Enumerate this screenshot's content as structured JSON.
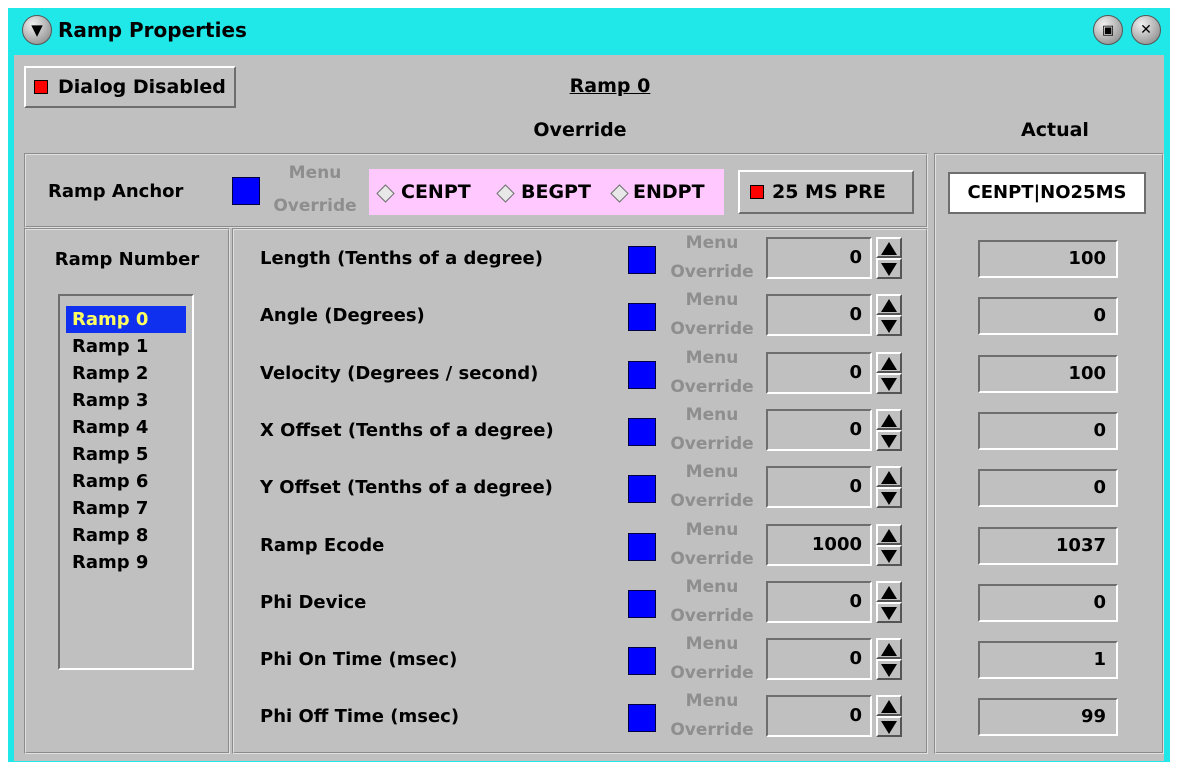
{
  "window": {
    "title": "Ramp Properties"
  },
  "header": {
    "dialog_disabled_label": "Dialog Disabled",
    "current_ramp": "Ramp 0",
    "override_heading": "Override",
    "actual_heading": "Actual"
  },
  "anchor": {
    "label": "Ramp Anchor",
    "menu_override": [
      "Menu",
      "Override"
    ],
    "options": [
      "CENPT",
      "BEGPT",
      "ENDPT"
    ],
    "pre_label": "25 MS PRE",
    "actual_value": "CENPT|NO25MS"
  },
  "ramp_list": {
    "heading": "Ramp Number",
    "selected_index": 0,
    "items": [
      "Ramp 0",
      "Ramp 1",
      "Ramp 2",
      "Ramp 3",
      "Ramp 4",
      "Ramp 5",
      "Ramp 6",
      "Ramp 7",
      "Ramp 8",
      "Ramp 9"
    ]
  },
  "params": [
    {
      "label": "Length (Tenths of a degree)",
      "menu": "Menu",
      "override": "Override",
      "value": "0",
      "actual": "100"
    },
    {
      "label": "Angle (Degrees)",
      "menu": "Menu",
      "override": "Override",
      "value": "0",
      "actual": "0"
    },
    {
      "label": "Velocity (Degrees / second)",
      "menu": "Menu",
      "override": "Override",
      "value": "0",
      "actual": "100"
    },
    {
      "label": "X Offset (Tenths of a degree)",
      "menu": "Menu",
      "override": "Override",
      "value": "0",
      "actual": "0"
    },
    {
      "label": "Y Offset (Tenths of a degree)",
      "menu": "Menu",
      "override": "Override",
      "value": "0",
      "actual": "0"
    },
    {
      "label": "Ramp Ecode",
      "menu": "Menu",
      "override": "Override",
      "value": "1000",
      "actual": "1037"
    },
    {
      "label": "Phi Device",
      "menu": "Menu",
      "override": "Override",
      "value": "0",
      "actual": "0"
    },
    {
      "label": "Phi On Time (msec)",
      "menu": "Menu",
      "override": "Override",
      "value": "0",
      "actual": "1"
    },
    {
      "label": "Phi Off Time (msec)",
      "menu": "Menu",
      "override": "Override",
      "value": "0",
      "actual": "99"
    }
  ],
  "colors": {
    "frame": "#20e8e8",
    "panel": "#c0c0c0",
    "override_box": "#0000ff",
    "led": "#ff0000",
    "selection": "#1030f0",
    "anchor_bg": "#ffc8ff"
  },
  "icons": [
    "window-menu-icon",
    "maximize-icon",
    "close-icon",
    "spin-up-icon",
    "spin-down-icon"
  ]
}
